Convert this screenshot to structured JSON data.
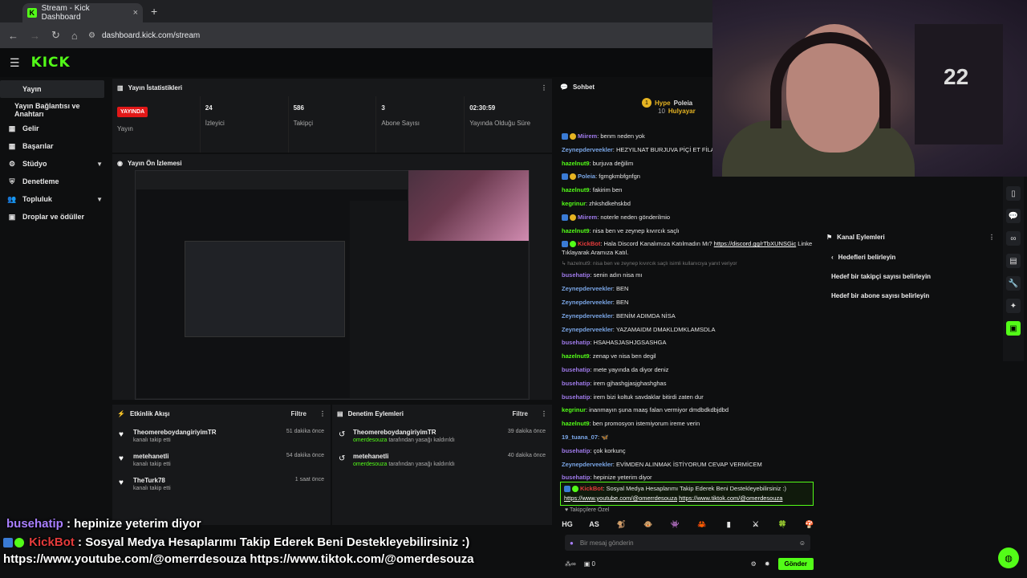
{
  "browser": {
    "tab_title": "Stream - Kick Dashboard",
    "tab_close": "×",
    "new_tab": "+",
    "url": "dashboard.kick.com/stream"
  },
  "kick": {
    "logo": "KICK"
  },
  "sidebar": {
    "items": [
      {
        "label": "Yayın",
        "icon": "broadcast-icon",
        "active": true
      },
      {
        "label": "Yayın Bağlantısı ve Anahtarı",
        "sub": true
      },
      {
        "label": "Gelir",
        "icon": "grid-icon"
      },
      {
        "label": "Başarılar",
        "icon": "grid-icon"
      },
      {
        "label": "Stüdyo",
        "icon": "gear-icon",
        "chevron": true
      },
      {
        "label": "Denetleme",
        "icon": "shield-icon"
      },
      {
        "label": "Topluluk",
        "icon": "people-icon",
        "chevron": true
      },
      {
        "label": "Droplar ve ödüller",
        "icon": "gift-icon"
      }
    ]
  },
  "stats": {
    "title": "Yayın İstatistikleri",
    "live_badge": "YAYINDA",
    "items": [
      {
        "value": "",
        "label": "Yayın"
      },
      {
        "value": "24",
        "label": "İzleyici"
      },
      {
        "value": "586",
        "label": "Takipçi"
      },
      {
        "value": "3",
        "label": "Abone Sayısı"
      },
      {
        "value": "02:30:59",
        "label": "Yayında Olduğu Süre"
      }
    ]
  },
  "preview": {
    "title": "Yayın Ön İzlemesi"
  },
  "events": {
    "title": "Etkinlik Akışı",
    "filter": "Filtre",
    "items": [
      {
        "name": "TheomereboydangiriyimTR",
        "desc": "kanalı takip etti",
        "time": "51 dakika önce"
      },
      {
        "name": "metehanetli",
        "desc": "kanalı takip etti",
        "time": "54 dakika önce"
      },
      {
        "name": "TheTurk78",
        "desc": "kanalı takip etti",
        "time": "1 saat önce"
      }
    ]
  },
  "moderation": {
    "title": "Denetim Eylemleri",
    "filter": "Filtre",
    "items": [
      {
        "name": "TheomereboydangiriyimTR",
        "by": "omerdesouza",
        "desc": " tarafından yasağı kaldırıldı",
        "time": "39 dakika önce"
      },
      {
        "name": "metehanetli",
        "by": "omerdesouza",
        "desc": " tarafından yasağı kaldırıldı",
        "time": "40 dakika önce"
      }
    ]
  },
  "chat": {
    "title": "Sohbet",
    "hype": "Hype",
    "hype_level": "10",
    "hype_user1": "Poleia",
    "hype_user2": "Hulyayar",
    "messages": [
      {
        "user": "Miirem",
        "color": "violet",
        "badges": true,
        "text": ": benm neden yok"
      },
      {
        "user": "Zeynepderveekler",
        "color": "blue",
        "text": ": HEZYILNAT BURJUVA PİÇİ ET FİLAN"
      },
      {
        "user": "hazelnut9",
        "color": "green",
        "text": ": burjuva değilim"
      },
      {
        "user": "Poleia",
        "color": "blue",
        "badges": true,
        "text": ": fgmgkmbfgnfgn"
      },
      {
        "user": "hazelnut9",
        "color": "green",
        "text": ": fakirim ben"
      },
      {
        "user": "kegrinur",
        "color": "green",
        "text": ": zhkshdkehskbd"
      },
      {
        "user": "Miirem",
        "color": "violet",
        "badges": true,
        "text": ": noterle neden gönderilmio"
      },
      {
        "user": "hazelnut9",
        "color": "green",
        "text": ": nisa ben ve zeynep kıvırcık saçlı"
      }
    ],
    "kickbot_msg": {
      "user": "KickBot",
      "text": ": Hala Discord Kanalımıza Katılmadın Mı? ",
      "link": "https://discord.gg/rTbXUNSGic",
      "text2": " Linke",
      "line2": "Tıklayarak Aramıza Katıl."
    },
    "reply_ref": "↳ hazelnut9: nisa ben ve zeynep kıvırcık saçlı isimli kullanıcıya yanıt veriyor",
    "messages2": [
      {
        "user": "busehatip",
        "color": "violet",
        "text": ": senin adın nisa mı"
      },
      {
        "user": "Zeynepderveekler",
        "color": "blue",
        "text": ": BEN"
      },
      {
        "user": "Zeynepderveekler",
        "color": "blue",
        "text": ": BEN"
      },
      {
        "user": "Zeynepderveekler",
        "color": "blue",
        "text": ": BENİM ADIMDA NİSA"
      },
      {
        "user": "Zeynepderveekler",
        "color": "blue",
        "text": ": YAZAMAIDM DMAKLDMKLAMSDLA"
      },
      {
        "user": "busehatip",
        "color": "violet",
        "text": ": HSAHASJASHJGSASHGA"
      },
      {
        "user": "hazelnut9",
        "color": "green",
        "text": ": zenap ve nisa ben degil"
      },
      {
        "user": "busehatip",
        "color": "violet",
        "text": ": mete yayında da diyor deniz"
      },
      {
        "user": "busehatip",
        "color": "violet",
        "text": ": irem gjhashgjasjghashghas"
      },
      {
        "user": "busehatip",
        "color": "violet",
        "text": ": irem bizi koltuk savdaklar bitirdi zaten dur"
      },
      {
        "user": "kegrinur",
        "color": "green",
        "text": ": inanmayın şuna maaş falan vermiyor dmdbdkdbjdbd"
      },
      {
        "user": "hazelnut9",
        "color": "green",
        "text": ": ben promosyon istemiyorum ireme verin"
      },
      {
        "user": "19_tuana_07",
        "color": "blue",
        "text": ": 🦋"
      },
      {
        "user": "busehatip",
        "color": "violet",
        "text": ": çok korkunç"
      },
      {
        "user": "Zeynepderveekler",
        "color": "blue",
        "text": ": EVİMDEN ALINMAK İSTİYORUM CEVAP VERMİCEM"
      },
      {
        "user": "busehatip",
        "color": "violet",
        "text": ": hepinize yeterim diyor"
      }
    ],
    "pinned": {
      "user": "KickBot",
      "text": ": Sosyal Medya Hesaplarımı Takip Ederek Beni Destekleyebilirsiniz :)",
      "link1": "https://www.youtube.com/@omerrdesouza",
      "link2": "https://www.tiktok.com/@omerdesouza"
    },
    "followers_label": "♥ Takipçilere Özel",
    "emotes": [
      "HG",
      "AS",
      "🐒",
      "🐵",
      "👾",
      "🦀",
      "▮",
      "⚔",
      "🍀",
      "🍄"
    ],
    "input_placeholder": "Bir mesaj gönderin",
    "viewer_count": "0",
    "send": "Gönder"
  },
  "actions": {
    "title": "Kanal Eylemleri",
    "back": "Hedefleri belirleyin",
    "items": [
      "Hedef bir takipçi sayısı belirleyin",
      "Hedef bir abone sayısı belirleyin"
    ]
  },
  "overlay": {
    "line1_user": "busehatip",
    "line1_text": " : hepinize yeterim diyor",
    "line2_user": "KickBot",
    "line2_text": " : Sosyal Medya Hesaplarımı Takip Ederek Beni Destekleyebilirsiniz :)",
    "line3": "https://www.youtube.com/@omerrdesouza https://www.tiktok.com/@omerdesouza"
  },
  "webcam": {
    "jacket_text": "22"
  },
  "colors": {
    "accent": "#53fc18",
    "live": "#e21818",
    "bg": "#0e0f10"
  }
}
